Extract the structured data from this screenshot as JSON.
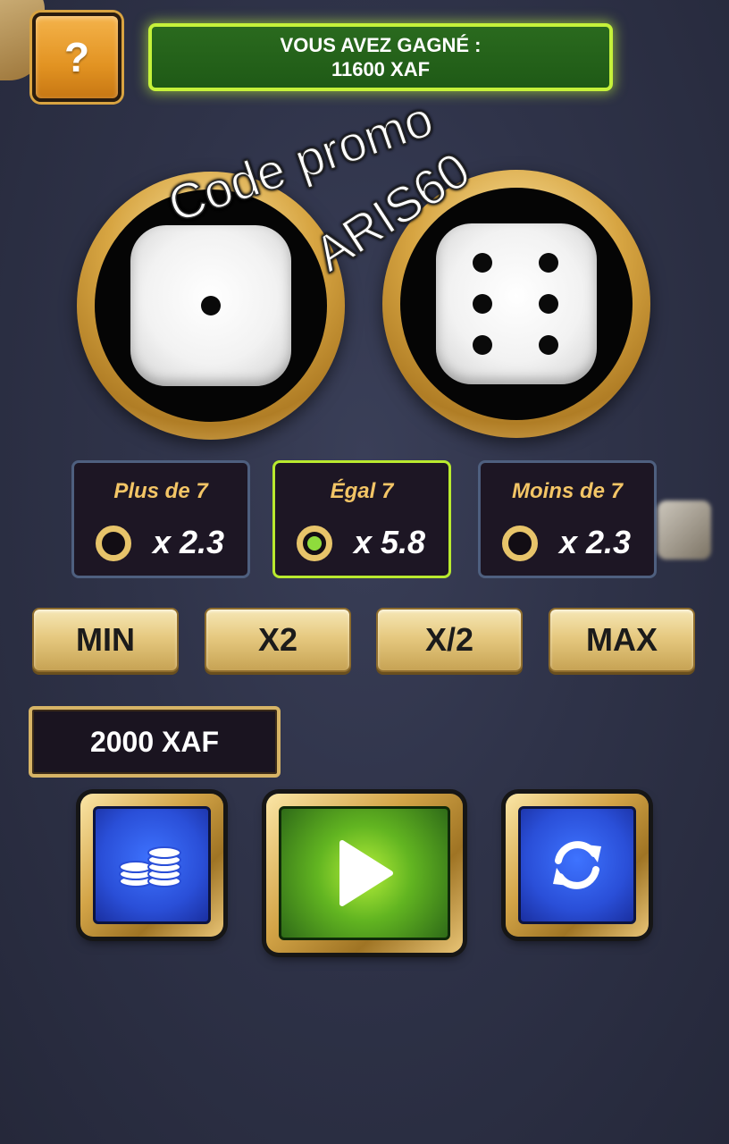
{
  "header": {
    "help_label": "?",
    "win_line1": "VOUS AVEZ GAGNÉ :",
    "win_line2": "11600 XAF"
  },
  "dice": [
    {
      "value": 1
    },
    {
      "value": 6
    }
  ],
  "watermark": {
    "line1": "Code promo",
    "line2": "ARIS60"
  },
  "bets": [
    {
      "label": "Plus de 7",
      "multiplier": "x 2.3",
      "selected": false
    },
    {
      "label": "Égal 7",
      "multiplier": "x 5.8",
      "selected": true
    },
    {
      "label": "Moins de 7",
      "multiplier": "x 2.3",
      "selected": false
    }
  ],
  "stake_buttons": {
    "min": "MIN",
    "double": "X2",
    "half": "X/2",
    "max": "MAX"
  },
  "stake_amount": "2000 XAF",
  "actions": {
    "coins_icon": "coins-stack-icon",
    "play_icon": "play-icon",
    "auto_icon": "refresh-icon"
  },
  "colors": {
    "selected_border": "#b9ea2e",
    "win_border": "#c6f23a",
    "gold": "#d7a542"
  }
}
